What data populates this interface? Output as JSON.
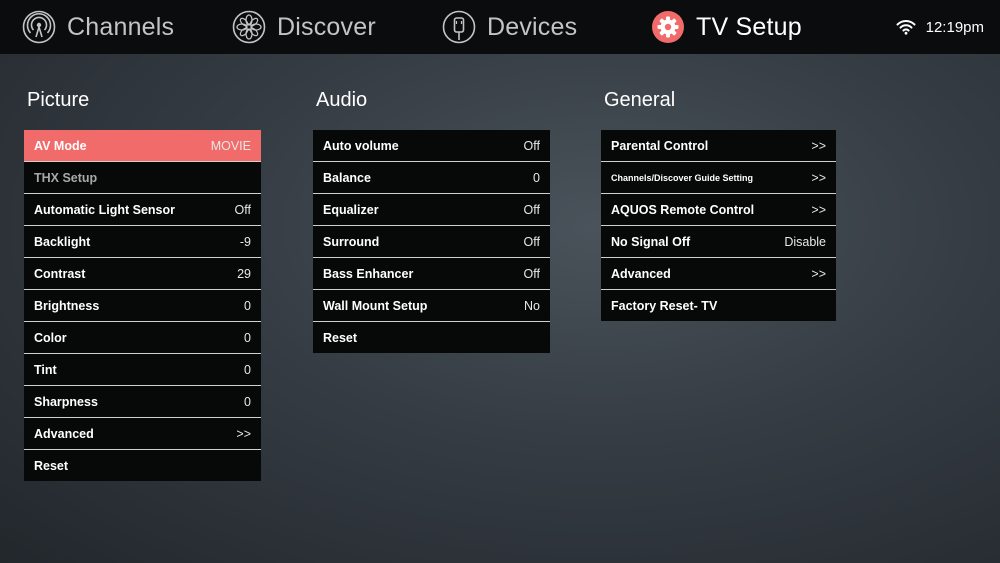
{
  "nav": {
    "channels": "Channels",
    "discover": "Discover",
    "devices": "Devices",
    "tv_setup": "TV Setup",
    "active": "tv_setup",
    "accent_color": "#f26b6b"
  },
  "status": {
    "time": "12:19pm",
    "wifi_icon": "wifi-icon"
  },
  "picture": {
    "title": "Picture",
    "items": [
      {
        "label": "AV Mode",
        "value": "MOVIE",
        "selected": true
      },
      {
        "label": "THX Setup",
        "value": "",
        "disabled": true
      },
      {
        "label": "Automatic Light Sensor",
        "value": "Off"
      },
      {
        "label": "Backlight",
        "value": "-9"
      },
      {
        "label": "Contrast",
        "value": "29"
      },
      {
        "label": "Brightness",
        "value": "0"
      },
      {
        "label": "Color",
        "value": "0"
      },
      {
        "label": "Tint",
        "value": "0"
      },
      {
        "label": "Sharpness",
        "value": "0"
      },
      {
        "label": "Advanced",
        "value": ">>"
      },
      {
        "label": "Reset",
        "value": ""
      }
    ]
  },
  "audio": {
    "title": "Audio",
    "items": [
      {
        "label": "Auto volume",
        "value": "Off"
      },
      {
        "label": "Balance",
        "value": "0"
      },
      {
        "label": "Equalizer",
        "value": "Off"
      },
      {
        "label": "Surround",
        "value": "Off"
      },
      {
        "label": "Bass Enhancer",
        "value": "Off"
      },
      {
        "label": "Wall Mount Setup",
        "value": "No"
      },
      {
        "label": "Reset",
        "value": ""
      }
    ]
  },
  "general": {
    "title": "General",
    "items": [
      {
        "label": "Parental Control",
        "value": ">>"
      },
      {
        "label": "Channels/Discover Guide Setting",
        "value": ">>"
      },
      {
        "label": "AQUOS Remote Control",
        "value": ">>"
      },
      {
        "label": "No Signal Off",
        "value": "Disable"
      },
      {
        "label": "Advanced",
        "value": ">>"
      },
      {
        "label": "Factory Reset- TV",
        "value": ""
      }
    ]
  }
}
